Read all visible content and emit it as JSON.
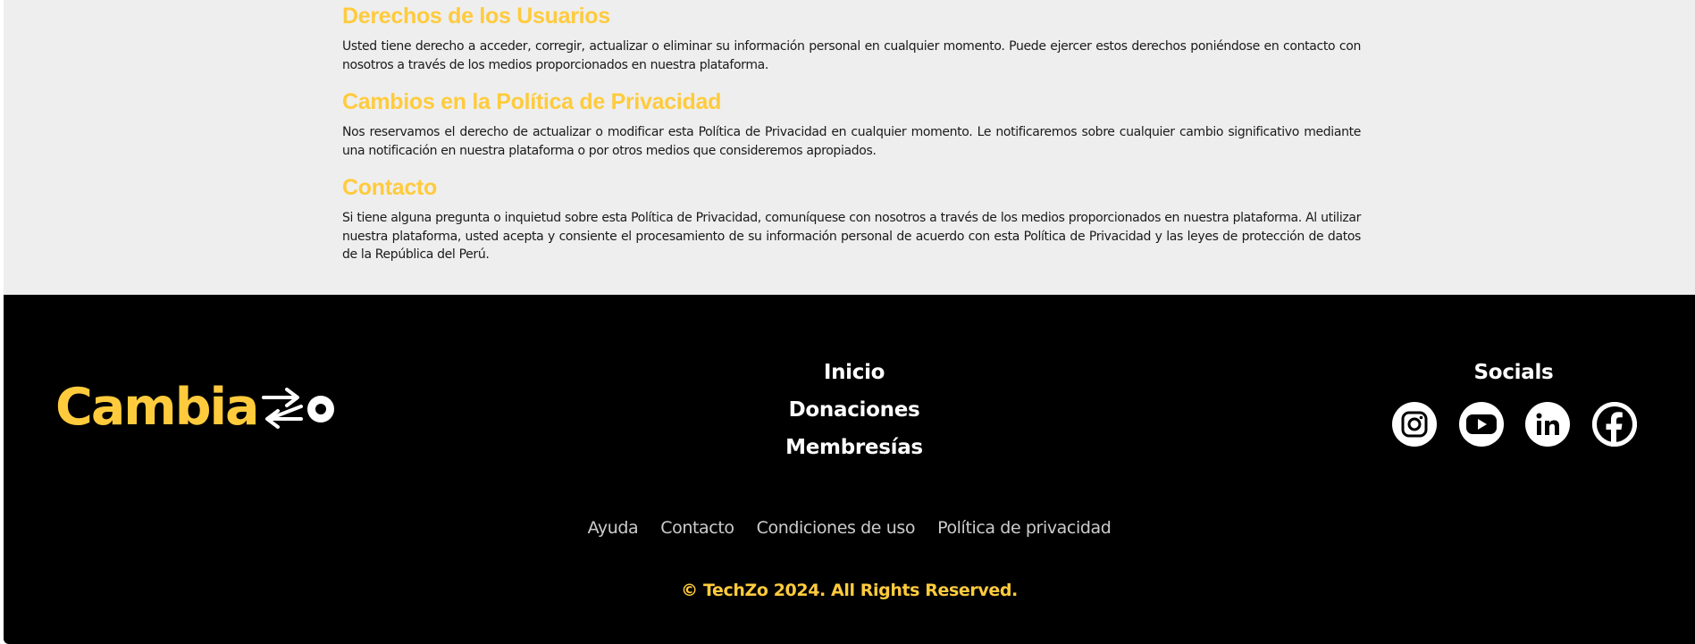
{
  "sections": [
    {
      "heading": "Derechos de los Usuarios",
      "body": "Usted tiene derecho a acceder, corregir, actualizar o eliminar su información personal en cualquier momento. Puede ejercer estos derechos poniéndose en contacto con nosotros a través de los medios proporcionados en nuestra plataforma."
    },
    {
      "heading": "Cambios en la Política de Privacidad",
      "body": "Nos reservamos el derecho de actualizar o modificar esta Política de Privacidad en cualquier momento. Le notificaremos sobre cualquier cambio significativo mediante una notificación en nuestra plataforma o por otros medios que consideremos apropiados."
    },
    {
      "heading": "Contacto",
      "body": "Si tiene alguna pregunta o inquietud sobre esta Política de Privacidad, comuníquese con nosotros a través de los medios proporcionados en nuestra plataforma. Al utilizar nuestra plataforma, usted acepta y consiente el procesamiento de su información personal de acuerdo con esta Política de Privacidad y las leyes de protección de datos de la República del Perú."
    }
  ],
  "footer": {
    "logo_text": "CambiaZo",
    "nav": [
      "Inicio",
      "Donaciones",
      "Membresías"
    ],
    "socials_title": "Socials",
    "socials": [
      "instagram-icon",
      "youtube-icon",
      "linkedin-icon",
      "facebook-icon"
    ],
    "links": [
      "Ayuda",
      "Contacto",
      "Condiciones de uso",
      "Política de privacidad"
    ],
    "copyright": "© TechZo 2024. All Rights Reserved."
  },
  "colors": {
    "accent": "#ffcb3d",
    "footer_bg": "#000000",
    "content_bg": "#eeeeee"
  }
}
